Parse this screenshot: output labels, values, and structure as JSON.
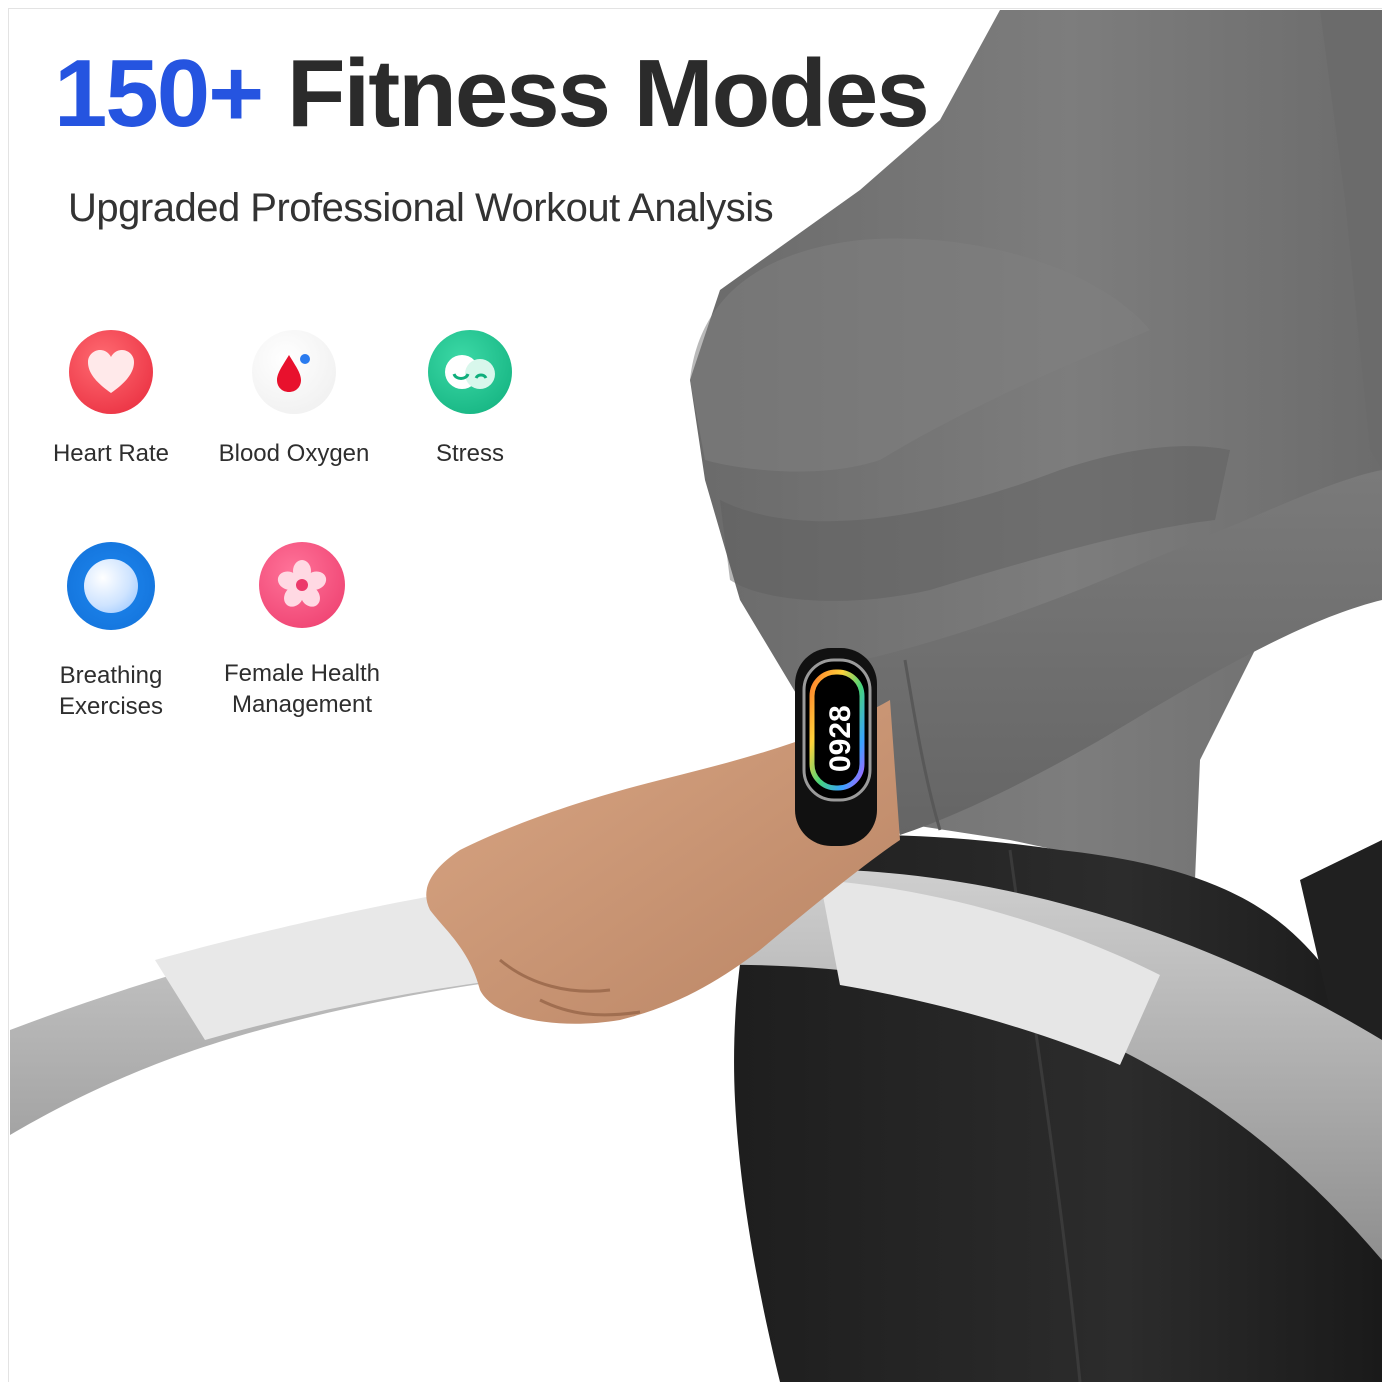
{
  "headline": {
    "number": "150+",
    "text": "Fitness Modes"
  },
  "subtitle": "Upgraded Professional Workout Analysis",
  "features": [
    {
      "label": "Heart Rate",
      "icon": "heart-icon",
      "color": "#ef3c4b"
    },
    {
      "label": "Blood Oxygen",
      "icon": "blood-drop-icon",
      "color": "#e8112d"
    },
    {
      "label": "Stress",
      "icon": "stress-face-icon",
      "color": "#19b98a"
    },
    {
      "label_lines": [
        "Breathing",
        "Exercises"
      ],
      "icon": "breathing-orb-icon",
      "color": "#1e88f0"
    },
    {
      "label_lines": [
        "Female Health",
        "Management"
      ],
      "icon": "flower-icon",
      "color": "#f24b7a"
    }
  ],
  "watch": {
    "time": "0928"
  },
  "colors": {
    "accent": "#2554e0",
    "headline": "#2b2b2b"
  }
}
